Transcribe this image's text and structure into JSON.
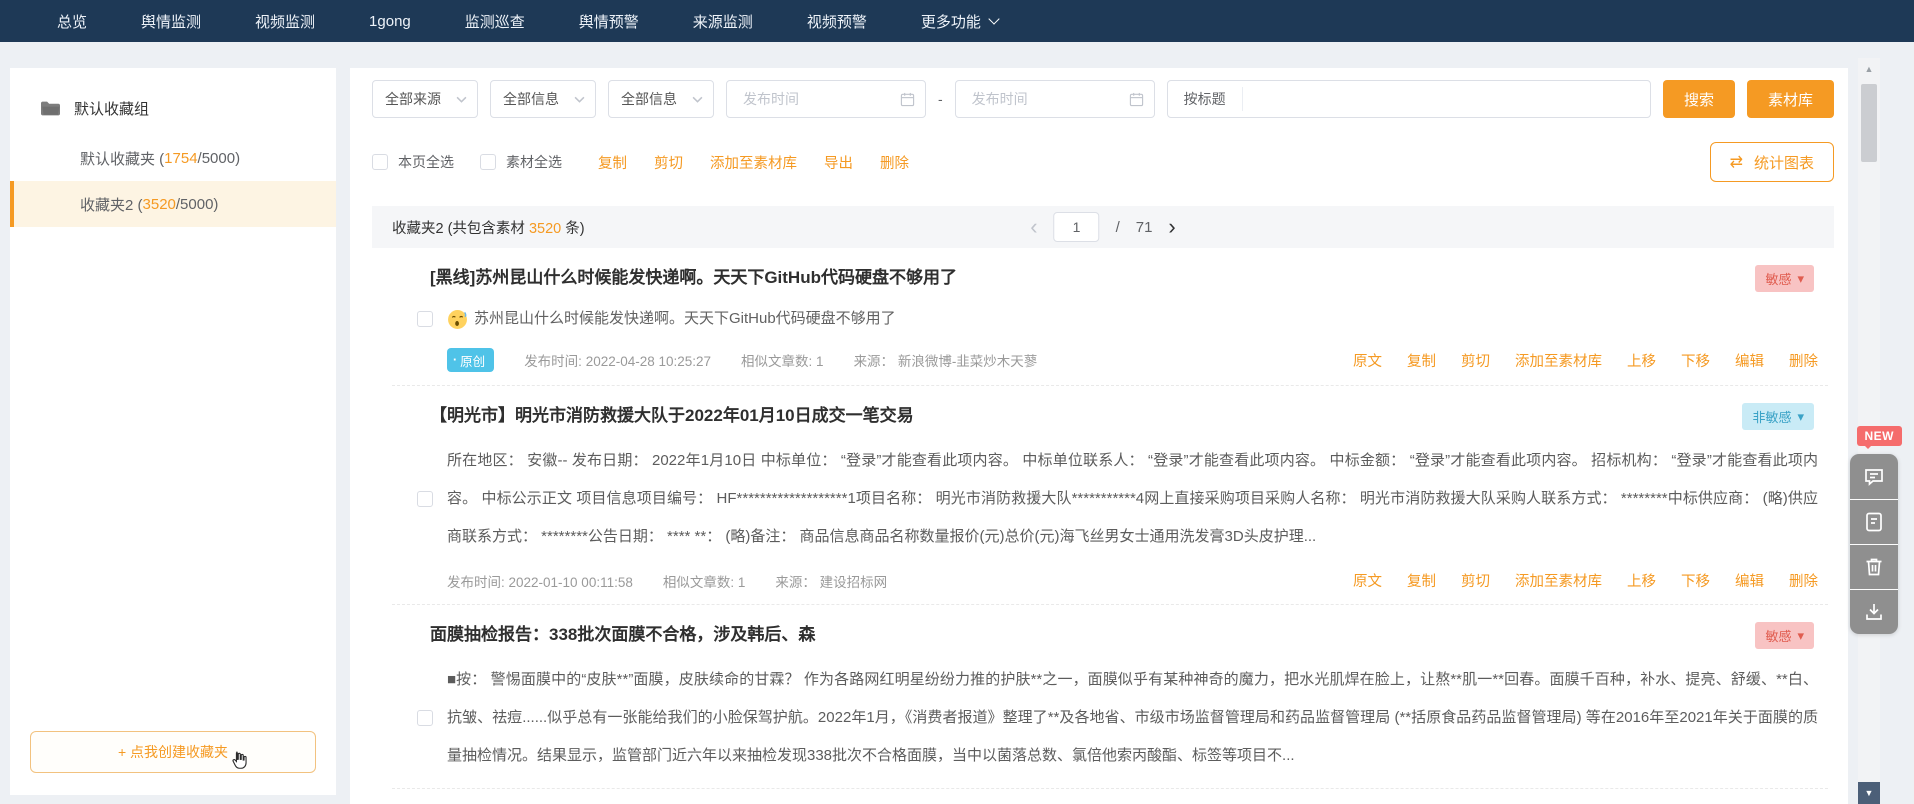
{
  "nav": {
    "items": [
      "总览",
      "舆情监测",
      "视频监测",
      "1gong",
      "监测巡查",
      "舆情预警",
      "来源监测",
      "视频预警"
    ],
    "more": "更多功能"
  },
  "sidebar": {
    "group_label": "默认收藏组",
    "folders": [
      {
        "pre": "默认收藏夹 (",
        "num": "1754",
        "post": "/5000)"
      },
      {
        "pre": "收藏夹2 (",
        "num": "3520",
        "post": "/5000)"
      }
    ],
    "create_label": "+ 点我创建收藏夹"
  },
  "filters": {
    "source": "全部来源",
    "info1": "全部信息",
    "info2": "全部信息",
    "date_start": "发布时间",
    "range_sep": "-",
    "date_end": "发布时间",
    "title_label": "按标题",
    "title_value": "",
    "search": "搜索",
    "material": "素材库"
  },
  "bulkbar": {
    "page_all": "本页全选",
    "material_all": "素材全选",
    "actions": [
      "复制",
      "剪切",
      "添加至素材库",
      "导出",
      "删除"
    ],
    "stats_icon": "⇄",
    "stats": "统计图表"
  },
  "list_header": {
    "pre": "收藏夹2 (共包含素材 ",
    "num": "3520",
    "post": " 条)",
    "pagination": {
      "prev": "‹",
      "page": "1",
      "sep": "/",
      "total": "71",
      "next": "›"
    }
  },
  "items": [
    {
      "title": "[黑线]苏州昆山什么时候能发快递啊。天天下GitHub代码硬盘不够用了",
      "badge": "敏感",
      "caret": "▾",
      "origin_tag": "原创",
      "content": "苏州昆山什么时候能发快递啊。天天下GitHub代码硬盘不够用了",
      "meta": [
        "发布时间: 2022-04-28 10:25:27",
        "相似文章数: 1",
        "来源： 新浪微博-韭菜炒木天蓼"
      ],
      "actions": [
        "原文",
        "复制",
        "剪切",
        "添加至素材库",
        "上移",
        "下移",
        "编辑",
        "删除"
      ]
    },
    {
      "title": "【明光市】明光市消防救援大队于2022年01月10日成交一笔交易",
      "badge": "非敏感",
      "caret": "▾",
      "content": "所在地区： 安徽-- 发布日期： 2022年1月10日 中标单位： “登录”才能查看此项内容。 中标单位联系人： “登录”才能查看此项内容。 中标金额： “登录”才能查看此项内容。 招标机构： “登录”才能查看此项内容。 中标公示正文 项目信息项目编号： HF*******************1项目名称： 明光市消防救援大队***********4网上直接采购项目采购人名称： 明光市消防救援大队采购人联系方式： ********中标供应商： (略)供应商联系方式： ********公告日期： **** **： (略)备注： 商品信息商品名称数量报价(元)总价(元)海飞丝男女士通用洗发膏3D头皮护理...",
      "meta": [
        "发布时间: 2022-01-10 00:11:58",
        "相似文章数: 1",
        "来源： 建设招标网"
      ],
      "actions": [
        "原文",
        "复制",
        "剪切",
        "添加至素材库",
        "上移",
        "下移",
        "编辑",
        "删除"
      ]
    },
    {
      "title": "面膜抽检报告：338批次面膜不合格，涉及韩后、森",
      "badge": "敏感",
      "caret": "▾",
      "content": "■按： 警惕面膜中的“皮肤**”面膜，皮肤续命的甘霖？ 作为各路网红明星纷纷力推的护肤**之一，面膜似乎有某种神奇的魔力，把水光肌焊在脸上，让熬**肌一**回春。面膜千百种，补水、提亮、舒缓、**白、抗皱、祛痘......似乎总有一张能给我们的小脸保驾护航。2022年1月，《消费者报道》整理了**及各地省、市级市场监督管理局和药品监督管理局 (**括原食品药品监督管理局) 等在2016年至2021年关于面膜的质量抽检情况。结果显示，监管部门近六年以来抽检发现338批次不合格面膜，当中以菌落总数、氯倍他索丙酸酯、标签等项目不..."
    }
  ],
  "dock": {
    "new_badge": "NEW",
    "buttons": [
      "comment",
      "document",
      "trash",
      "download"
    ]
  },
  "colors": {
    "accent": "#f59a23",
    "nav_bg": "#1e3956",
    "sensitive_bg": "#f8c3c3",
    "sensitive_text": "#e05c4f",
    "nonsensitive_bg": "#c9ebf6",
    "nonsensitive_text": "#3aa2c6",
    "origin_tag_bg": "#4fc3e8",
    "new_badge_bg": "#f56c6c"
  }
}
